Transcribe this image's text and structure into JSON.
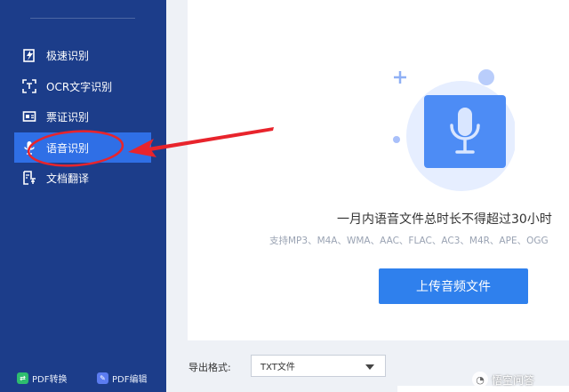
{
  "sidebar": {
    "items": [
      {
        "label": "极速识别",
        "icon": "fast-recognize-icon"
      },
      {
        "label": "OCR文字识别",
        "icon": "ocr-scan-icon"
      },
      {
        "label": "票证识别",
        "icon": "ticket-icon"
      },
      {
        "label": "语音识别",
        "icon": "microphone-icon",
        "active": true
      },
      {
        "label": "文档翻译",
        "icon": "translate-icon"
      }
    ],
    "bottom": {
      "pdf_convert": "PDF转换",
      "pdf_edit": "PDF编辑"
    }
  },
  "main": {
    "headline": "一月内语音文件总时长不得超过30小时",
    "formats": "支持MP3、M4A、WMA、AAC、FLAC、AC3、M4R、APE、OGG",
    "upload_label": "上传音频文件"
  },
  "export": {
    "label": "导出格式:",
    "selected": "TXT文件"
  },
  "watermark": "悟空问答",
  "colors": {
    "sidebar_bg": "#1c3d8a",
    "active_bg": "#2f6fe6",
    "accent": "#2f80ed",
    "annotation_red": "#e8242c"
  }
}
